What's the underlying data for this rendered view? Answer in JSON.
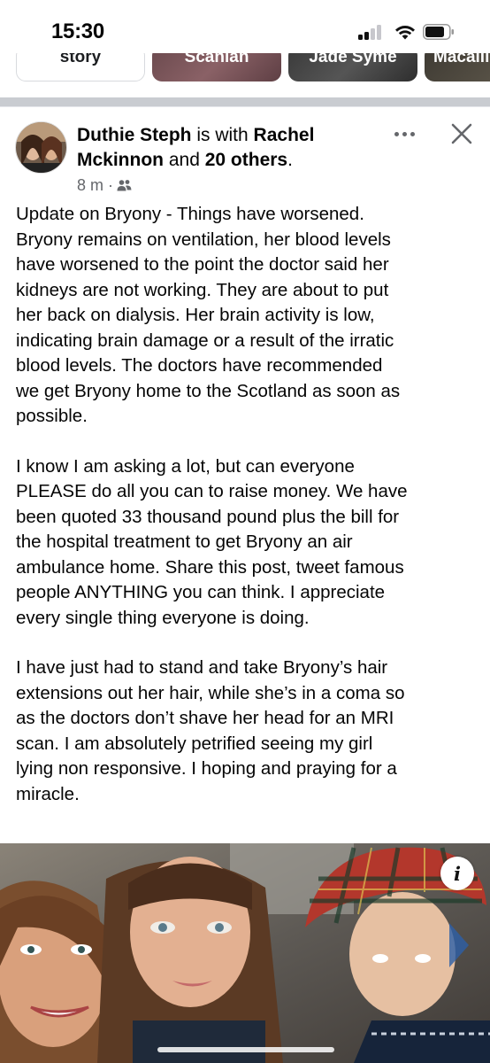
{
  "status_bar": {
    "time": "15:30",
    "cellular": "signal-icon",
    "wifi": "wifi-icon",
    "battery": "battery-icon"
  },
  "stories": [
    {
      "label": "story"
    },
    {
      "label": "Scanlan"
    },
    {
      "label": "Jade Syme"
    },
    {
      "label": "Macalli"
    }
  ],
  "post": {
    "author": "Duthie Steph",
    "with_text": "is with",
    "tagged": "Rachel Mckinnon",
    "and_text": "and",
    "others": "20 others",
    "period": ".",
    "time": "8 m",
    "separator": "·",
    "audience_icon": "friends-icon",
    "menu_icon": "more-icon",
    "close_icon": "close-icon",
    "paragraphs": [
      "Update on Bryony - Things have worsened.\nBryony remains on ventilation, her blood levels\nhave worsened to the point the doctor said her\nkidneys are not working. They are about to put\nher back on dialysis. Her brain activity is low,\nindicating brain damage or a result of the irratic\nblood levels.  The doctors have recommended\nwe get Bryony home to the Scotland as soon as\npossible.",
      "I know I am asking a lot, but can everyone\nPLEASE do all you can to raise money. We have\nbeen quoted 33 thousand pound plus the bill for\nthe hospital treatment to get Bryony an air\nambulance home. Share this post, tweet famous\npeople ANYTHING you can think. I appreciate\nevery single thing everyone is doing.",
      "I have just had to stand and take Bryony’s hair\nextensions out her hair, while she’s in a coma so\nas the doctors don’t shave her head for an MRI\nscan. I am absolutely petrified seeing my girl\nlying non responsive. I  hoping and praying for a\nmiracle."
    ],
    "photo_info": "i"
  },
  "colors": {
    "text": "#050505",
    "secondary": "#65676b",
    "separator": "#c9ccd1"
  }
}
